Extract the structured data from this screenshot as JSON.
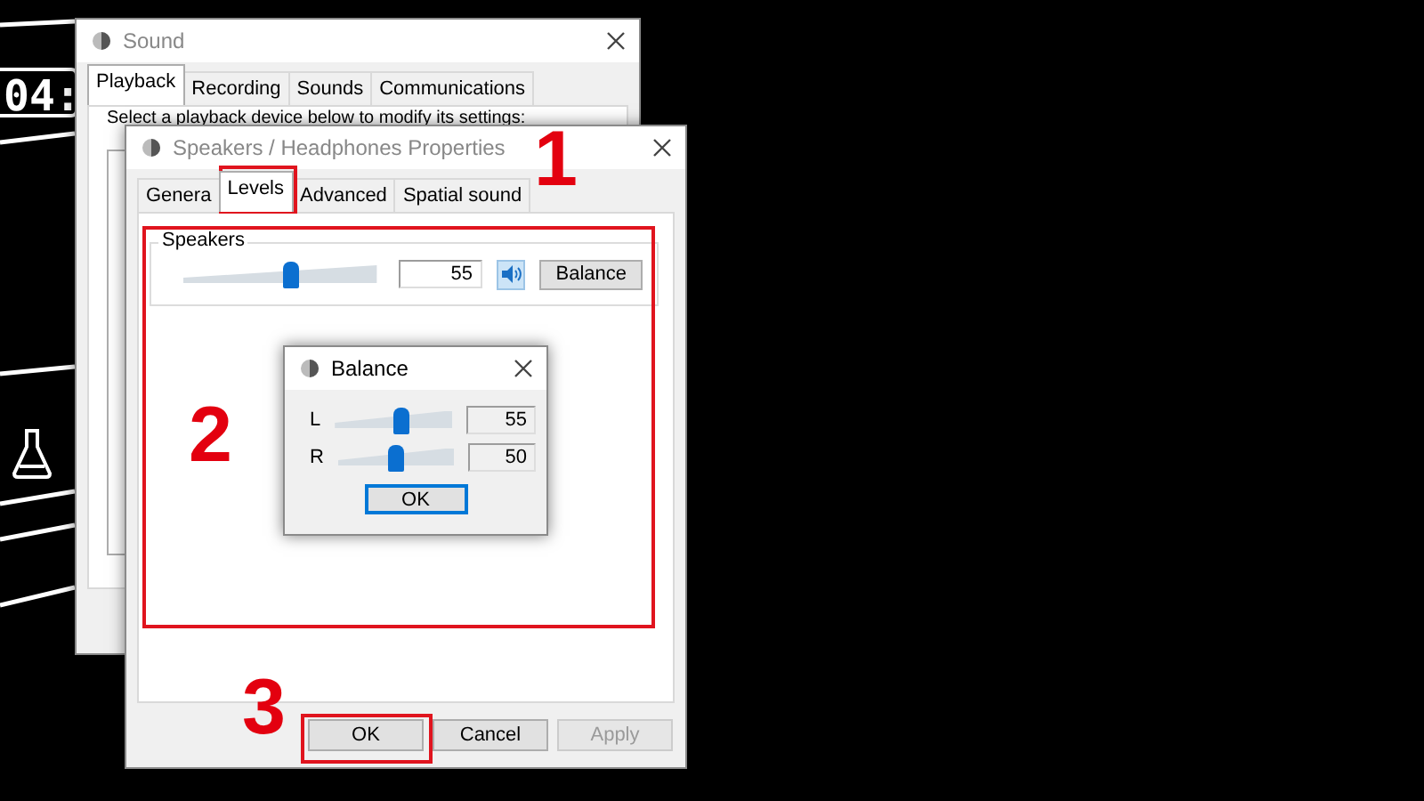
{
  "background": {
    "clock": "04:"
  },
  "sound_window": {
    "title": "Sound",
    "tabs": [
      {
        "label": "Playback",
        "selected": true
      },
      {
        "label": "Recording",
        "selected": false
      },
      {
        "label": "Sounds",
        "selected": false
      },
      {
        "label": "Communications",
        "selected": false
      }
    ],
    "instruction": "Select a playback device below to modify its settings:"
  },
  "properties_window": {
    "title": "Speakers / Headphones Properties",
    "tabs": [
      {
        "label": "Genera",
        "selected": false
      },
      {
        "label": "Levels",
        "selected": true
      },
      {
        "label": "Advanced",
        "selected": false
      },
      {
        "label": "Spatial sound",
        "selected": false
      }
    ],
    "speakers": {
      "label": "Speakers",
      "level": 0.55,
      "value": "55",
      "balance_button": "Balance"
    },
    "buttons": [
      {
        "label": "OK",
        "disabled": false
      },
      {
        "label": "Cancel",
        "disabled": false
      },
      {
        "label": "Apply",
        "disabled": true
      }
    ]
  },
  "balance_dialog": {
    "title": "Balance",
    "channels": [
      {
        "name": "L",
        "level": 0.55,
        "value": "55"
      },
      {
        "name": "R",
        "level": 0.5,
        "value": "50"
      }
    ],
    "button": "OK"
  },
  "annotations": [
    {
      "label": "1"
    },
    {
      "label": "2"
    },
    {
      "label": "3"
    }
  ]
}
